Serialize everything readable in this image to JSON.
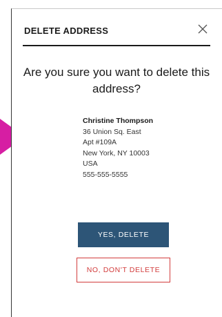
{
  "dialog": {
    "title": "DELETE ADDRESS",
    "close_icon": "close-icon",
    "question": "Are you sure you want to delete this address?"
  },
  "address": {
    "name": "Christine Thompson",
    "line1": "36 Union Sq. East",
    "line2": "Apt #109A",
    "city_state_zip": "New York, NY 10003",
    "country": "USA",
    "phone": "555-555-5555"
  },
  "buttons": {
    "confirm_label": "YES, DELETE",
    "cancel_label": "NO, DON'T DELETE"
  },
  "colors": {
    "confirm_bg": "#2d5577",
    "cancel_accent": "#d23b3b",
    "pointer": "#d61ea3"
  }
}
